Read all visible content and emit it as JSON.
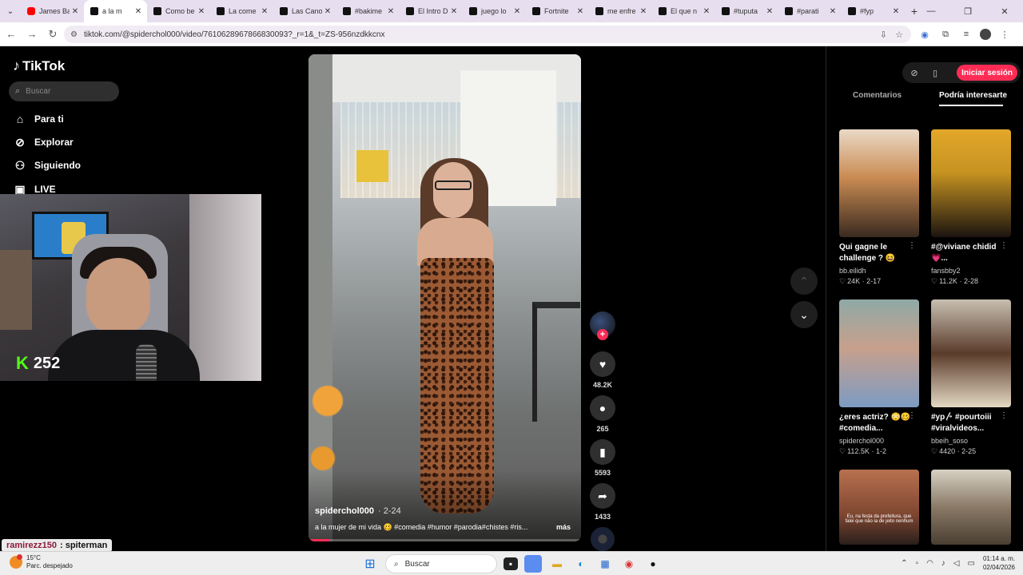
{
  "browser": {
    "tabs": [
      {
        "title": "James Ba",
        "icon": "youtube-icon"
      },
      {
        "title": "a la m",
        "icon": "tiktok-icon",
        "active": true
      },
      {
        "title": "Como be",
        "icon": "tiktok-icon"
      },
      {
        "title": "La come",
        "icon": "tiktok-icon"
      },
      {
        "title": "Las Cano",
        "icon": "tiktok-icon"
      },
      {
        "title": "#bakime",
        "icon": "tiktok-icon"
      },
      {
        "title": "El Intro D",
        "icon": "tiktok-icon"
      },
      {
        "title": "juego lo",
        "icon": "tiktok-icon"
      },
      {
        "title": "Fortnite",
        "icon": "tiktok-icon"
      },
      {
        "title": "me enfre",
        "icon": "tiktok-icon"
      },
      {
        "title": "El que n",
        "icon": "tiktok-icon"
      },
      {
        "title": "#tuputa",
        "icon": "tiktok-icon"
      },
      {
        "title": "#parati",
        "icon": "tiktok-icon"
      },
      {
        "title": "#fyp",
        "icon": "tiktok-icon"
      }
    ],
    "url": "tiktok.com/@spiderchol000/video/7610628967866830093?_r=1&_t=ZS-956nzdkkcnx"
  },
  "sidebar": {
    "logo": "TikTok",
    "search_placeholder": "Buscar",
    "nav": [
      {
        "label": "Para ti",
        "icon": "home-icon"
      },
      {
        "label": "Explorar",
        "icon": "compass-icon"
      },
      {
        "label": "Siguiendo",
        "icon": "following-icon"
      },
      {
        "label": "LIVE",
        "icon": "live-icon"
      }
    ]
  },
  "webcam": {
    "viewer_count": "252",
    "platform_icon": "kick-icon"
  },
  "video": {
    "author": "spiderchol000",
    "date": "2-24",
    "caption": "a la mujer de mi vida 🥴 #comedia #humor #parodia#chistes #ris...",
    "more": "más",
    "progress": 0.08
  },
  "actions": {
    "likes": "48.2K",
    "comments": "265",
    "saves": "5593",
    "shares": "1433"
  },
  "right_panel": {
    "login": "Iniciar sesión",
    "tab_comments": "Comentarios",
    "tab_suggested": "Podría interesarte",
    "cards": [
      {
        "title": "Qui gagne le challenge ? 😆",
        "user": "bb.eilidh",
        "likes": "24K",
        "date": "2-17"
      },
      {
        "title": "#@viviane chidid 💗...",
        "user": "fansbby2",
        "likes": "11.2K",
        "date": "2-28"
      },
      {
        "title": "¿eres actriz? 😳🥴 #comedia...",
        "user": "spiderchol000",
        "likes": "112.5K",
        "date": "1-2"
      },
      {
        "title": "#yp〴 #pourtoiii #viralvideos...",
        "user": "bbeih_soso",
        "likes": "4420",
        "date": "2-25"
      },
      {
        "title": "",
        "user": "",
        "likes": "",
        "date": "",
        "subtitle": "Eu, na festa da prefeitura, que falei que não ia de jeito nenhum"
      },
      {
        "title": "",
        "user": "",
        "likes": "",
        "date": ""
      }
    ]
  },
  "chat": {
    "user": "ramirezz150",
    "message": ": spiterman"
  },
  "taskbar": {
    "temp": "15°C",
    "weather": "Parc. despejado",
    "search": "Buscar",
    "time": "01:14 a. m.",
    "date": "02/04/2026"
  }
}
